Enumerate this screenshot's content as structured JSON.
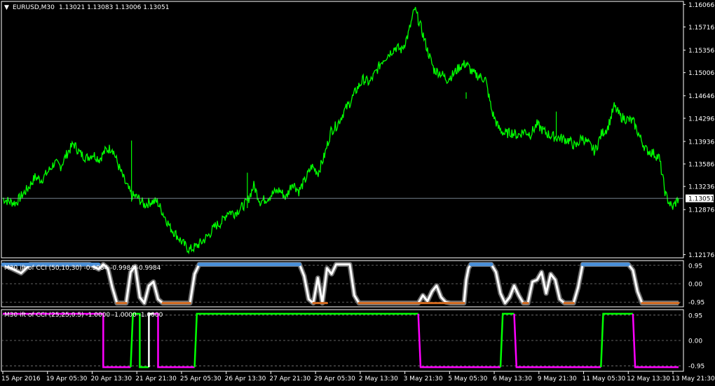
{
  "colors": {
    "background": "#000000",
    "frame": "#ffffff",
    "price": "#00ff00",
    "price_line": "#a0b0c0",
    "price_box_bg": "#ffffff",
    "price_box_text": "#000000",
    "level_dash": "#808080",
    "ind_fast": "#ffffff",
    "ind_slow": "#707070",
    "ind_top_marks": "#4a90d9",
    "ind_bottom_marks": "#d2691e",
    "sig_up": "#00ff00",
    "sig_down": "#ff00ff",
    "sig_neutral": "#ffffff"
  },
  "header": {
    "menu_arrow": "▼",
    "symbol": "EURUSD,M30",
    "ohlc": "1.13021 1.13083 1.13006 1.13051"
  },
  "chart_data": [
    {
      "type": "line",
      "panel": "price",
      "title": "EURUSD,M30 1.13021 1.13083 1.13006 1.13051",
      "xlabel": "",
      "ylabel": "",
      "ylim": [
        1.1217,
        1.1607
      ],
      "yticks": [
        "1.16066",
        "1.15716",
        "1.15356",
        "1.15006",
        "1.14646",
        "1.14296",
        "1.13936",
        "1.13586",
        "1.13236",
        "1.12876",
        "1.12176"
      ],
      "current_price": "1.13051",
      "grid": false,
      "series": [
        {
          "color": "#00ff00",
          "values": [
            1.1305,
            1.13,
            1.1298,
            1.131,
            1.1322,
            1.1338,
            1.1334,
            1.1346,
            1.136,
            1.1355,
            1.1375,
            1.139,
            1.1375,
            1.1368,
            1.1374,
            1.1366,
            1.138,
            1.1384,
            1.1355,
            1.133,
            1.131,
            1.1306,
            1.1295,
            1.13,
            1.13,
            1.128,
            1.126,
            1.1248,
            1.1235,
            1.1225,
            1.123,
            1.1238,
            1.1248,
            1.1262,
            1.1268,
            1.1285,
            1.1282,
            1.129,
            1.13,
            1.1325,
            1.13,
            1.1305,
            1.1313,
            1.1318,
            1.1306,
            1.133,
            1.1316,
            1.1334,
            1.1355,
            1.1345,
            1.1372,
            1.141,
            1.142,
            1.144,
            1.1455,
            1.1475,
            1.149,
            1.1485,
            1.1502,
            1.152,
            1.153,
            1.154,
            1.1536,
            1.156,
            1.16,
            1.157,
            1.1535,
            1.1505,
            1.15,
            1.149,
            1.1498,
            1.151,
            1.1515,
            1.15,
            1.1495,
            1.149,
            1.144,
            1.1415,
            1.1405,
            1.1408,
            1.1403,
            1.141,
            1.1405,
            1.142,
            1.141,
            1.1403,
            1.14,
            1.1398,
            1.1395,
            1.1385,
            1.14,
            1.139,
            1.1378,
            1.1405,
            1.1415,
            1.1448,
            1.1432,
            1.1428,
            1.1424,
            1.14,
            1.138,
            1.1376,
            1.1368,
            1.131,
            1.129,
            1.1305
          ]
        }
      ],
      "x_tick_labels": [
        "15 Apr 2016",
        "19 Apr 05:30",
        "20 Apr 13:30",
        "21 Apr 21:30",
        "25 Apr 05:30",
        "26 Apr 13:30",
        "27 Apr 21:30",
        "29 Apr 05:30",
        "2 May 13:30",
        "3 May 21:30",
        "5 May 05:30",
        "6 May 13:30",
        "9 May 21:30",
        "11 May 05:30",
        "12 May 13:30",
        "13 May 21:30"
      ]
    },
    {
      "type": "line",
      "panel": "indicator-1",
      "title": "M30 ift of CCI (50,10,30) -0.9984 -0.9984 -0.9984",
      "ylim": [
        -1.05,
        1.05
      ],
      "yticks": [
        "0.95",
        "0.00",
        "-0.95"
      ],
      "levels": [
        0.95,
        0,
        -0.95
      ],
      "series": [
        {
          "color": "#ffffff",
          "points": [
            [
              0,
              1
            ],
            [
              4,
              0.55
            ],
            [
              6,
              1
            ],
            [
              19,
              1
            ],
            [
              21,
              0.75
            ],
            [
              22,
              1
            ],
            [
              23,
              0.8
            ],
            [
              24,
              -0.2
            ],
            [
              25,
              -1
            ],
            [
              27,
              -1
            ],
            [
              28,
              0.6
            ],
            [
              29,
              0.9
            ],
            [
              30,
              -0.7
            ],
            [
              31,
              -1
            ],
            [
              32,
              -0.1
            ],
            [
              33,
              0.1
            ],
            [
              34,
              -0.8
            ],
            [
              35,
              -1
            ],
            [
              41,
              -1
            ],
            [
              42,
              0.5
            ],
            [
              43,
              1
            ],
            [
              65,
              1
            ],
            [
              66,
              0.4
            ],
            [
              67,
              -0.8
            ],
            [
              68,
              -1
            ],
            [
              69,
              0.3
            ],
            [
              70,
              -1
            ],
            [
              71,
              0.8
            ],
            [
              72,
              0.5
            ],
            [
              73,
              1
            ],
            [
              76,
              1
            ],
            [
              77,
              -0.6
            ],
            [
              78,
              -1
            ],
            [
              91,
              -1
            ],
            [
              92,
              -0.6
            ],
            [
              93,
              -0.9
            ],
            [
              94,
              -0.4
            ],
            [
              95,
              -0.1
            ],
            [
              96,
              -0.7
            ],
            [
              97,
              -0.95
            ],
            [
              98,
              -1
            ],
            [
              101,
              -1
            ],
            [
              101.5,
              0.2
            ],
            [
              102,
              0.8
            ],
            [
              102.5,
              1
            ],
            [
              107,
              1
            ],
            [
              108,
              0.6
            ],
            [
              109,
              -0.5
            ],
            [
              110,
              -1
            ],
            [
              111,
              -0.7
            ],
            [
              112,
              -0.1
            ],
            [
              113,
              -0.6
            ],
            [
              114,
              -1
            ],
            [
              115,
              -1
            ],
            [
              116,
              0.1
            ],
            [
              117,
              0.2
            ],
            [
              118,
              0.6
            ],
            [
              119,
              -0.5
            ],
            [
              120,
              0.5
            ],
            [
              121,
              0.2
            ],
            [
              122,
              -0.8
            ],
            [
              123,
              -1
            ],
            [
              125,
              -1
            ],
            [
              126,
              -0.2
            ],
            [
              127,
              1
            ],
            [
              137,
              1
            ],
            [
              138,
              0.7
            ],
            [
              139,
              -0.4
            ],
            [
              140,
              -1
            ],
            [
              148,
              -1
            ]
          ]
        }
      ]
    },
    {
      "type": "line",
      "panel": "indicator-2",
      "title": "M30 ift of CCI (25,25,0.5) -1.0000 -1.0000 -1.0000",
      "ylim": [
        -1.05,
        1.05
      ],
      "yticks": [
        "0.95",
        "0.00",
        "-0.95"
      ],
      "levels": [
        0.95,
        0,
        -0.95
      ],
      "segments": [
        {
          "color": "#ff00ff",
          "points": [
            [
              0,
              1
            ],
            [
              22,
              1
            ],
            [
              22,
              -1
            ],
            [
              28,
              -1
            ]
          ]
        },
        {
          "color": "#00ff00",
          "points": [
            [
              28,
              -1
            ],
            [
              28.5,
              1
            ],
            [
              30,
              1
            ],
            [
              30,
              -1
            ],
            [
              32,
              -1
            ]
          ]
        },
        {
          "color": "#ffffff",
          "points": [
            [
              32,
              -1
            ],
            [
              32,
              1
            ],
            [
              33,
              1
            ]
          ]
        },
        {
          "color": "#ff00ff",
          "points": [
            [
              33,
              1
            ],
            [
              34,
              1
            ],
            [
              34,
              -1
            ],
            [
              42,
              -1
            ]
          ]
        },
        {
          "color": "#00ff00",
          "points": [
            [
              42,
              -1
            ],
            [
              42.5,
              1
            ],
            [
              91,
              1
            ]
          ]
        },
        {
          "color": "#ff00ff",
          "points": [
            [
              91,
              1
            ],
            [
              91.5,
              -1
            ],
            [
              109,
              -1
            ]
          ]
        },
        {
          "color": "#00ff00",
          "points": [
            [
              109,
              -1
            ],
            [
              109.5,
              1
            ],
            [
              112,
              1
            ]
          ]
        },
        {
          "color": "#ff00ff",
          "points": [
            [
              112,
              1
            ],
            [
              112.5,
              -1
            ],
            [
              131,
              -1
            ]
          ]
        },
        {
          "color": "#00ff00",
          "points": [
            [
              131,
              -1
            ],
            [
              131.5,
              1
            ],
            [
              138,
              1
            ]
          ]
        },
        {
          "color": "#ff00ff",
          "points": [
            [
              138,
              1
            ],
            [
              138.5,
              -1
            ],
            [
              148,
              -1
            ]
          ]
        }
      ]
    }
  ]
}
